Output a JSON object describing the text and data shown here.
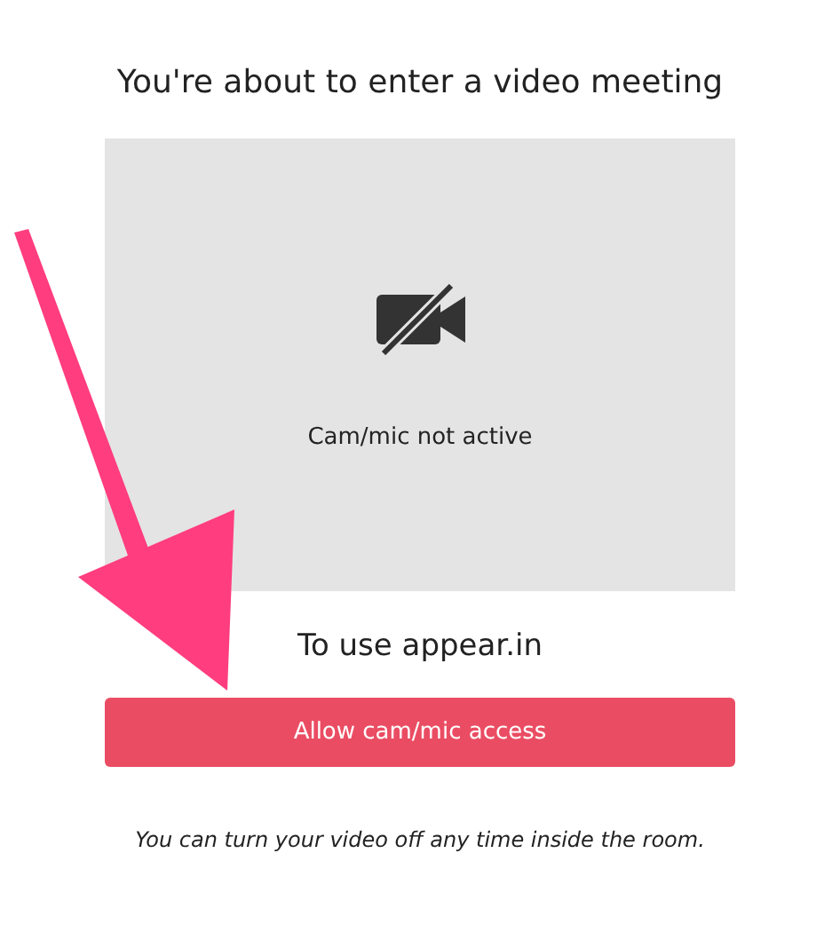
{
  "title": "You're about to enter a video meeting",
  "preview": {
    "status": "Cam/mic not active"
  },
  "subtitle": "To use appear.in",
  "button": "Allow cam/mic access",
  "note": "You can turn your video off any time inside the room."
}
